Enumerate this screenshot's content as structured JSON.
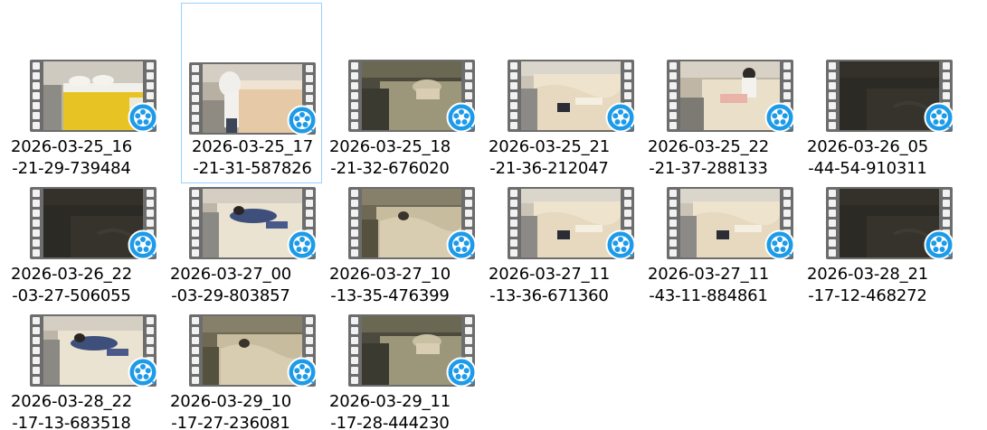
{
  "files": [
    {
      "name_line1": "2026-03-25_16",
      "name_line2": "-21-29-739484",
      "icon": "video-file-icon",
      "scene": "yellow-bed"
    },
    {
      "name_line1": "2026-03-25_17",
      "name_line2": "-21-31-587826",
      "icon": "video-file-icon",
      "scene": "person-bed",
      "hovered": true
    },
    {
      "name_line1": "2026-03-25_18",
      "name_line2": "-21-32-676020",
      "icon": "video-file-icon",
      "scene": "dim-person"
    },
    {
      "name_line1": "2026-03-25_21",
      "name_line2": "-21-36-212047",
      "icon": "video-file-icon",
      "scene": "messy-bed"
    },
    {
      "name_line1": "2026-03-25_22",
      "name_line2": "-21-37-288133",
      "icon": "video-file-icon",
      "scene": "person-sitting"
    },
    {
      "name_line1": "2026-03-26_05",
      "name_line2": "-44-54-910311",
      "icon": "video-file-icon",
      "scene": "dark"
    },
    {
      "name_line1": "2026-03-26_22",
      "name_line2": "-03-27-506055",
      "icon": "video-file-icon",
      "scene": "dark"
    },
    {
      "name_line1": "2026-03-27_00",
      "name_line2": "-03-29-803857",
      "icon": "video-file-icon",
      "scene": "sleeping-blue"
    },
    {
      "name_line1": "2026-03-27_10",
      "name_line2": "-13-35-476399",
      "icon": "video-file-icon",
      "scene": "dim-bed"
    },
    {
      "name_line1": "2026-03-27_11",
      "name_line2": "-13-36-671360",
      "icon": "video-file-icon",
      "scene": "messy-bed"
    },
    {
      "name_line1": "2026-03-27_11",
      "name_line2": "-43-11-884861",
      "icon": "video-file-icon",
      "scene": "messy-bed"
    },
    {
      "name_line1": "2026-03-28_21",
      "name_line2": "-17-12-468272",
      "icon": "video-file-icon",
      "scene": "dark"
    },
    {
      "name_line1": "2026-03-28_22",
      "name_line2": "-17-13-683518",
      "icon": "video-file-icon",
      "scene": "sleeping-blue"
    },
    {
      "name_line1": "2026-03-29_10",
      "name_line2": "-17-27-236081",
      "icon": "video-file-icon",
      "scene": "dim-bed"
    },
    {
      "name_line1": "2026-03-29_11",
      "name_line2": "-17-28-444230",
      "icon": "video-file-icon",
      "scene": "dim-person"
    }
  ],
  "colors": {
    "hover_border": "#99d1ff",
    "badge_blue": "#1e9be8",
    "film_gray": "#6d6d6d"
  }
}
